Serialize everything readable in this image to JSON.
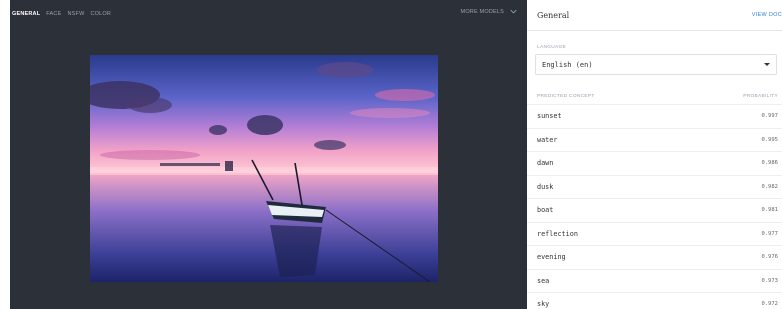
{
  "tabs": [
    {
      "label": "GENERAL",
      "active": true
    },
    {
      "label": "FACE",
      "active": false
    },
    {
      "label": "NSFW",
      "active": false
    },
    {
      "label": "COLOR",
      "active": false
    }
  ],
  "more_models": {
    "label": "MORE MODELS",
    "icon": "chevron-down-icon"
  },
  "panel": {
    "title": "General",
    "view_docs": "VIEW DOC",
    "language_label": "LANGUAGE",
    "language_value": "English (en)",
    "table_header": {
      "concept": "PREDICTED CONCEPT",
      "probability": "PROBABILITY"
    },
    "rows": [
      {
        "concept": "sunset",
        "probability": "0.997"
      },
      {
        "concept": "water",
        "probability": "0.995"
      },
      {
        "concept": "dawn",
        "probability": "0.986"
      },
      {
        "concept": "dusk",
        "probability": "0.982"
      },
      {
        "concept": "boat",
        "probability": "0.981"
      },
      {
        "concept": "reflection",
        "probability": "0.977"
      },
      {
        "concept": "evening",
        "probability": "0.976"
      },
      {
        "concept": "sea",
        "probability": "0.973"
      },
      {
        "concept": "sky",
        "probability": "0.972"
      }
    ]
  },
  "colors": {
    "left_bg": "#2b3039",
    "link": "#2f7fd6"
  }
}
